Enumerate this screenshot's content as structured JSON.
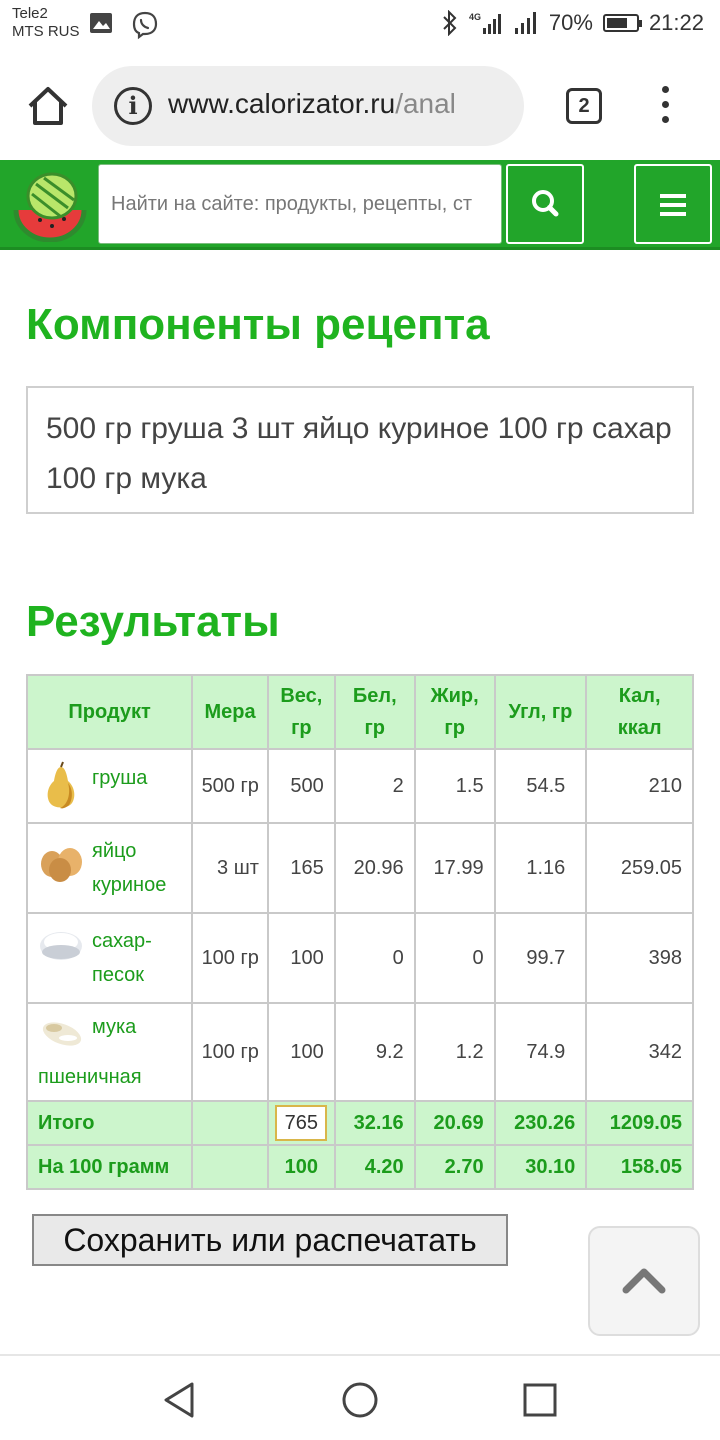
{
  "status_bar": {
    "carrier_1": "Tele2",
    "carrier_2": "MTS RUS",
    "battery": "70%",
    "time": "21:22"
  },
  "browser": {
    "url_host": "www.calorizator.ru",
    "url_path": "/anal",
    "tab_count": "2"
  },
  "site_header": {
    "search_placeholder": "Найти на сайте: продукты, рецепты, ст"
  },
  "components": {
    "title": "Компоненты рецепта",
    "text": "500 гр груша 3 шт яйцо куриное 100 гр сахар 100 гр мука"
  },
  "results": {
    "title": "Результаты",
    "columns": [
      "Продукт",
      "Мера",
      "Вес, гр",
      "Бел, гр",
      "Жир, гр",
      "Угл, гр",
      "Кал, ккал"
    ],
    "rows": [
      {
        "product": "груша",
        "measure": "500 гр",
        "weight": "500",
        "protein": "2",
        "fat": "1.5",
        "carbs": "54.5",
        "kcal": "210"
      },
      {
        "product": "яйцо куриное",
        "measure": "3 шт",
        "weight": "165",
        "protein": "20.96",
        "fat": "17.99",
        "carbs": "1.16",
        "kcal": "259.05"
      },
      {
        "product": "сахар-песок",
        "measure": "100 гр",
        "weight": "100",
        "protein": "0",
        "fat": "0",
        "carbs": "99.7",
        "kcal": "398"
      },
      {
        "product": "мука пшеничная",
        "measure": "100 гр",
        "weight": "100",
        "protein": "9.2",
        "fat": "1.2",
        "carbs": "74.9",
        "kcal": "342"
      }
    ],
    "total": {
      "label": "Итого",
      "weight": "765",
      "protein": "32.16",
      "fat": "20.69",
      "carbs": "230.26",
      "kcal": "1209.05"
    },
    "per100": {
      "label": "На 100 грамм",
      "weight": "100",
      "protein": "4.20",
      "fat": "2.70",
      "carbs": "30.10",
      "kcal": "158.05"
    }
  },
  "buttons": {
    "save_print": "Сохранить или распечатать"
  },
  "colors": {
    "brand_green": "#22a52a",
    "heading_green": "#1fb31f",
    "table_header_bg": "#ccf5cc"
  }
}
